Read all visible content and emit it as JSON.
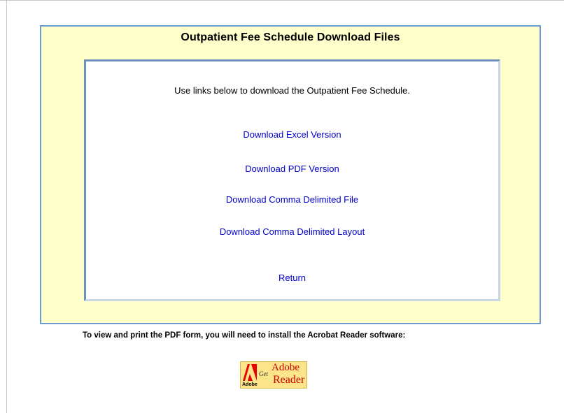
{
  "panel": {
    "title": "Outpatient Fee Schedule Download Files",
    "intro": "Use links below to download the Outpatient Fee Schedule."
  },
  "links": {
    "excel": "Download Excel Version",
    "pdf": "Download PDF Version",
    "comma_file": "Download Comma Delimited File",
    "comma_layout": "Download Comma Delimited Layout",
    "return": "Return"
  },
  "note": "To view and print the PDF form, you will need to install the Acrobat Reader software:",
  "adobe_badge": {
    "small_label": "Adobe",
    "get": "Get",
    "brand": "Adobe",
    "product": "Reader",
    "icon": "adobe-logo-icon",
    "brand_color": "#cc0000"
  },
  "colors": {
    "panel_background": "#ffffcc",
    "panel_border": "#6b9bd2",
    "link": "#0000cc"
  }
}
